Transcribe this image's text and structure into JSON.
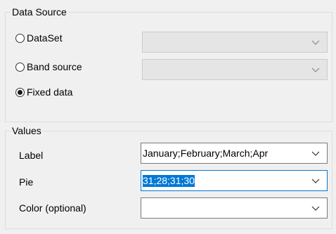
{
  "data_source": {
    "title": "Data Source",
    "options": [
      {
        "label": "DataSet",
        "checked": false
      },
      {
        "label": "Band source",
        "checked": false
      },
      {
        "label": "Fixed data",
        "checked": true
      }
    ]
  },
  "values": {
    "title": "Values",
    "label_field": {
      "label": "Label",
      "value": "January;February;March;Apr"
    },
    "pie_field": {
      "label": "Pie",
      "value": "31;28;31;30"
    },
    "color_field": {
      "label": "Color (optional)",
      "value": ""
    }
  },
  "icons": {
    "dropdown": "chevron-down-icon"
  },
  "colors": {
    "selection": "#0078d7",
    "background": "#f0f0f0"
  }
}
